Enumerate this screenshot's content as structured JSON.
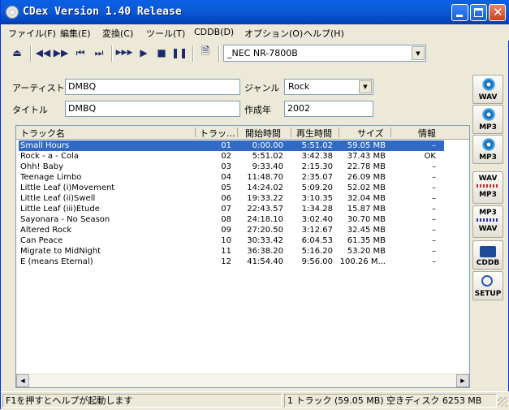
{
  "window": {
    "title": "CDex Version 1.40 Release"
  },
  "menu": [
    "ファイル(F)",
    "編集(E)",
    "変換(C)",
    "ツール(T)",
    "CDDB(D)",
    "オプション(O)",
    "ヘルプ(H)"
  ],
  "drive": {
    "selected": "_NEC    NR-7800B"
  },
  "fields": {
    "artist_label": "アーティスト",
    "artist": "DMBQ",
    "genre_label": "ジャンル",
    "genre": "Rock",
    "title_label": "タイトル",
    "title": "DMBQ",
    "year_label": "作成年",
    "year": "2002"
  },
  "columns": [
    "トラック名",
    "トラッ...",
    "開始時間",
    "再生時間",
    "サイズ",
    "情報"
  ],
  "tracks": [
    {
      "name": "Small Hours",
      "no": "01",
      "start": "0:00.00",
      "length": "5:51.02",
      "size": "59.05 MB",
      "info": "–"
    },
    {
      "name": "Rock - a - Cola",
      "no": "02",
      "start": "5:51.02",
      "length": "3:42.38",
      "size": "37.43 MB",
      "info": "OK"
    },
    {
      "name": "Ohh! Baby",
      "no": "03",
      "start": "9:33.40",
      "length": "2:15.30",
      "size": "22.78 MB",
      "info": "–"
    },
    {
      "name": "Teenage Limbo",
      "no": "04",
      "start": "11:48.70",
      "length": "2:35.07",
      "size": "26.09 MB",
      "info": "–"
    },
    {
      "name": "Little Leaf (i)Movement",
      "no": "05",
      "start": "14:24.02",
      "length": "5:09.20",
      "size": "52.02 MB",
      "info": "–"
    },
    {
      "name": "Little Leaf (ii)Swell",
      "no": "06",
      "start": "19:33.22",
      "length": "3:10.35",
      "size": "32.04 MB",
      "info": "–"
    },
    {
      "name": "Little Leaf (iii)Etude",
      "no": "07",
      "start": "22:43.57",
      "length": "1:34.28",
      "size": "15.87 MB",
      "info": "–"
    },
    {
      "name": "Sayonara - No Season",
      "no": "08",
      "start": "24:18.10",
      "length": "3:02.40",
      "size": "30.70 MB",
      "info": "–"
    },
    {
      "name": "Altered Rock",
      "no": "09",
      "start": "27:20.50",
      "length": "3:12.67",
      "size": "32.45 MB",
      "info": "–"
    },
    {
      "name": "Can Peace",
      "no": "10",
      "start": "30:33.42",
      "length": "6:04.53",
      "size": "61.35 MB",
      "info": "–"
    },
    {
      "name": "Migrate to MidNight",
      "no": "11",
      "start": "36:38.20",
      "length": "5:16.20",
      "size": "53.20 MB",
      "info": "–"
    },
    {
      "name": "E (means Eternal)",
      "no": "12",
      "start": "41:54.40",
      "length": "9:56.00",
      "size": "100.26 M...",
      "info": "–"
    }
  ],
  "side_buttons": [
    {
      "icon": "cd-to-wav-icon",
      "label": "WAV"
    },
    {
      "icon": "cd-to-mp3-icon",
      "label": "MP3"
    },
    {
      "icon": "cd-to-mp3-alt-icon",
      "label": "MP3"
    },
    {
      "icon": "wav-to-mp3-icon",
      "label1": "WAV",
      "label2": "MP3"
    },
    {
      "icon": "mp3-to-wav-icon",
      "label1": "MP3",
      "label2": "WAV"
    },
    {
      "icon": "cddb-icon",
      "label": "CDDB"
    },
    {
      "icon": "setup-icon",
      "label": "SETUP"
    }
  ],
  "status": {
    "help": "F1を押すとヘルプが起動します",
    "info": "1 トラック (59.05 MB) 空きディスク   6253 MB"
  },
  "colors": {
    "selection": "#316ac5",
    "titlebar": "#0a5fe4"
  }
}
